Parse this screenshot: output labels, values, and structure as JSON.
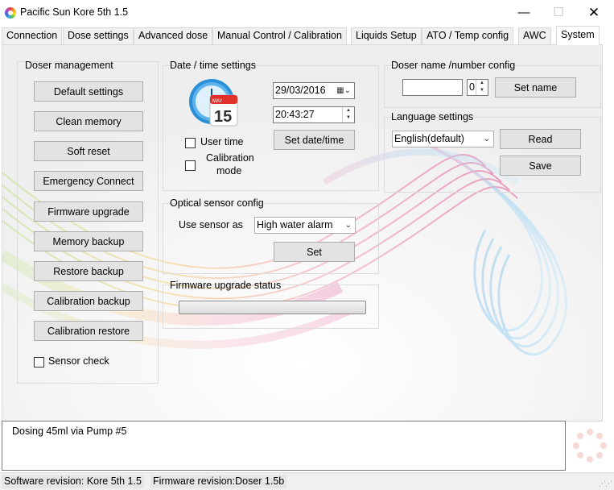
{
  "window": {
    "title": "Pacific Sun Kore 5th 1.5",
    "controls": {
      "minimize": "—",
      "maximize": "☐",
      "close": "✕"
    }
  },
  "tabs": [
    {
      "label": "Connection"
    },
    {
      "label": "Dose settings"
    },
    {
      "label": "Advanced dose"
    },
    {
      "label": "Manual Control / Calibration"
    },
    {
      "label": "Liquids Setup"
    },
    {
      "label": "ATO / Temp config"
    },
    {
      "label": "AWC"
    },
    {
      "label": "System",
      "active": true
    }
  ],
  "doser_management": {
    "title": "Doser management",
    "buttons": [
      "Default settings",
      "Clean memory",
      "Soft reset",
      "Emergency Connect",
      "Firmware upgrade",
      "Memory backup",
      "Restore backup",
      "Calibration backup",
      "Calibration restore"
    ],
    "sensor_check": {
      "label": "Sensor check",
      "checked": false
    }
  },
  "datetime": {
    "title": "Date / time settings",
    "calendar_day": "15",
    "calendar_month": "MAY",
    "date_value": "29/03/2016",
    "time_value": "20:43:27",
    "user_time": {
      "label": "User time",
      "checked": false
    },
    "calibration_mode": {
      "label_line1": "Calibration",
      "label_line2": "mode",
      "checked": false
    },
    "set_button": "Set date/time"
  },
  "optical": {
    "title": "Optical sensor config",
    "label": "Use sensor as",
    "selected": "High water alarm",
    "set_button": "Set"
  },
  "firmware_status": {
    "title": "Firmware upgrade status",
    "progress": 0
  },
  "doser_name": {
    "title": "Doser name /number config",
    "name_value": "",
    "number_value": "0",
    "set_button": "Set name"
  },
  "language": {
    "title": "Language settings",
    "selected": "English(default)",
    "read_button": "Read",
    "save_button": "Save"
  },
  "log": {
    "text": "Dosing 45ml via Pump #5"
  },
  "status": {
    "software": "Software revision: Kore 5th 1.5",
    "firmware": "Firmware revision:Doser 1.5b"
  },
  "icons": {
    "combo_arrow": "⌄",
    "spin_up": "▲",
    "spin_down": "▼"
  }
}
